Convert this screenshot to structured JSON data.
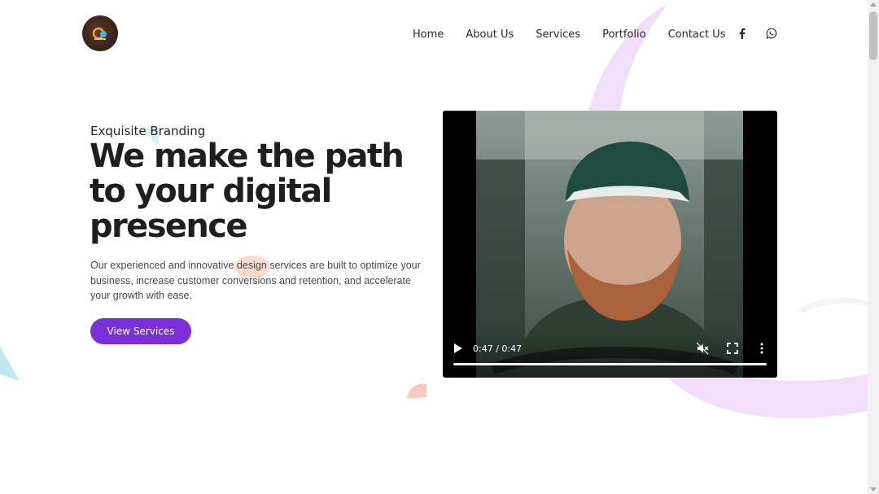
{
  "header": {
    "logo_icon": "site-logo",
    "nav": [
      "Home",
      "About Us",
      "Services",
      "Portfolio",
      "Contact Us"
    ],
    "social_icons": [
      "facebook-icon",
      "whatsapp-icon"
    ]
  },
  "hero": {
    "eyebrow": "Exquisite Branding",
    "headline_lines": [
      "We make the path",
      "to your digital",
      "presence"
    ],
    "description": "Our experienced and innovative design services are built to optimize your business, increase customer conversions and retention, and accelerate your growth with ease.",
    "cta_label": "View Services"
  },
  "video": {
    "time": "0:47 / 0:47",
    "progress": 1.0,
    "icons": [
      "play-icon",
      "muted-icon",
      "fullscreen-icon",
      "more-options-icon"
    ]
  },
  "colors": {
    "accent": "#7b2fd6",
    "deco_lilac": "#f1defb",
    "deco_cyan": "#bfe8ef",
    "deco_peach": "#f9c9bd"
  }
}
